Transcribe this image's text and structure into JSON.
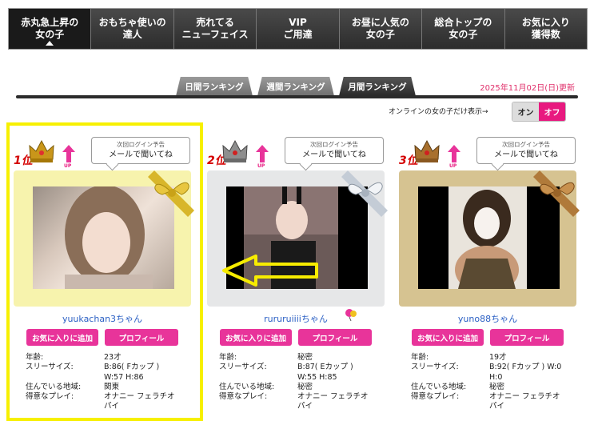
{
  "nav": {
    "items": [
      {
        "line1": "赤丸急上昇の",
        "line2": "女の子",
        "active": true
      },
      {
        "line1": "おもちゃ使いの",
        "line2": "達人"
      },
      {
        "line1": "売れてる",
        "line2": "ニューフェイス"
      },
      {
        "line1": "VIP",
        "line2": "ご用達"
      },
      {
        "line1": "お昼に人気の",
        "line2": "女の子"
      },
      {
        "line1": "総合トップの",
        "line2": "女の子"
      },
      {
        "line1": "お気に入り",
        "line2": "獲得数"
      }
    ]
  },
  "tabs": [
    "日間ランキング",
    "週間ランキング",
    "月間ランキング"
  ],
  "updated": "2025年11月02日(日)更新",
  "online": {
    "label": "オンラインの女の子だけ表示→",
    "on": "オン",
    "off": "オフ"
  },
  "cards": [
    {
      "rank": "1位",
      "up": "UP",
      "login_small": "次回ログイン予告",
      "login_big": "メールで聞いてね",
      "frame_color": "#f7f0a8",
      "ribbon_color": "#d9b423",
      "name": "yuukachan3ちゃん",
      "fav": "お気に入りに追加",
      "profile": "プロフィール",
      "stats": [
        {
          "k": "年齢:",
          "v": "23才"
        },
        {
          "k": "スリーサイズ:",
          "v": "B:86( Fカップ )"
        },
        {
          "k": "",
          "v": "W:57 H:86"
        },
        {
          "k": "住んでいる地域:",
          "v": "関東"
        },
        {
          "k": "得意なプレイ:",
          "v": "オナニー フェラチオ パイ"
        }
      ]
    },
    {
      "rank": "2位",
      "up": "UP",
      "login_small": "次回ログイン予告",
      "login_big": "メールで聞いてね",
      "frame_color": "#e4e4e4",
      "ribbon_color": "#b8c0cc",
      "name": "rururuiiiiちゃん",
      "fav": "お気に入りに追加",
      "profile": "プロフィール",
      "stats": [
        {
          "k": "年齢:",
          "v": "秘密"
        },
        {
          "k": "スリーサイズ:",
          "v": "B:87( Eカップ )"
        },
        {
          "k": "",
          "v": "W:55 H:85"
        },
        {
          "k": "住んでいる地域:",
          "v": "秘密"
        },
        {
          "k": "得意なプレイ:",
          "v": "オナニー フェラチオ パイ"
        }
      ]
    },
    {
      "rank": "3位",
      "up": "UP",
      "login_small": "次回ログイン予告",
      "login_big": "メールで聞いてね",
      "frame_color": "#d8c594",
      "ribbon_color": "#b07a3a",
      "name": "yuno88ちゃん",
      "fav": "お気に入りに追加",
      "profile": "プロフィール",
      "stats": [
        {
          "k": "年齢:",
          "v": "19才"
        },
        {
          "k": "スリーサイズ:",
          "v": "B:92( Fカップ ) W:0"
        },
        {
          "k": "",
          "v": "H:0"
        },
        {
          "k": "住んでいる地域:",
          "v": "秘密"
        },
        {
          "k": "得意なプレイ:",
          "v": "オナニー フェラチオ パイ"
        }
      ]
    }
  ]
}
